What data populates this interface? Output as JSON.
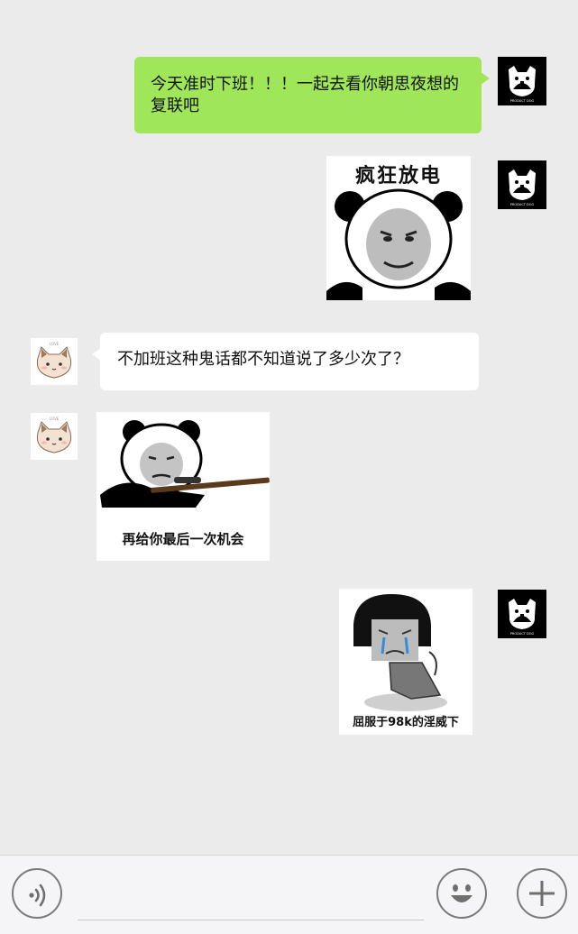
{
  "messages": {
    "m1": {
      "text": "今天准时下班！！！一起去看你朝思夜想的复联吧"
    },
    "m2": {
      "sticker_text": "疯狂放电"
    },
    "m3": {
      "text": "不加班这种鬼话都不知道说了多少次了？"
    },
    "m4": {
      "sticker_text": "再给你最后一次机会"
    },
    "m5": {
      "sticker_text": "屈服于98k的淫威下"
    }
  },
  "avatars": {
    "me_label": "PRODUCT DOG",
    "other_label": "LOVE"
  },
  "input_bar": {
    "text_value": "",
    "voice_icon": "voice-icon",
    "emoji_icon": "emoji-icon",
    "plus_icon": "plus-icon"
  },
  "colors": {
    "background": "#ebebeb",
    "my_bubble": "#9fe658",
    "their_bubble": "#ffffff",
    "input_bar": "#f5f5f7"
  }
}
